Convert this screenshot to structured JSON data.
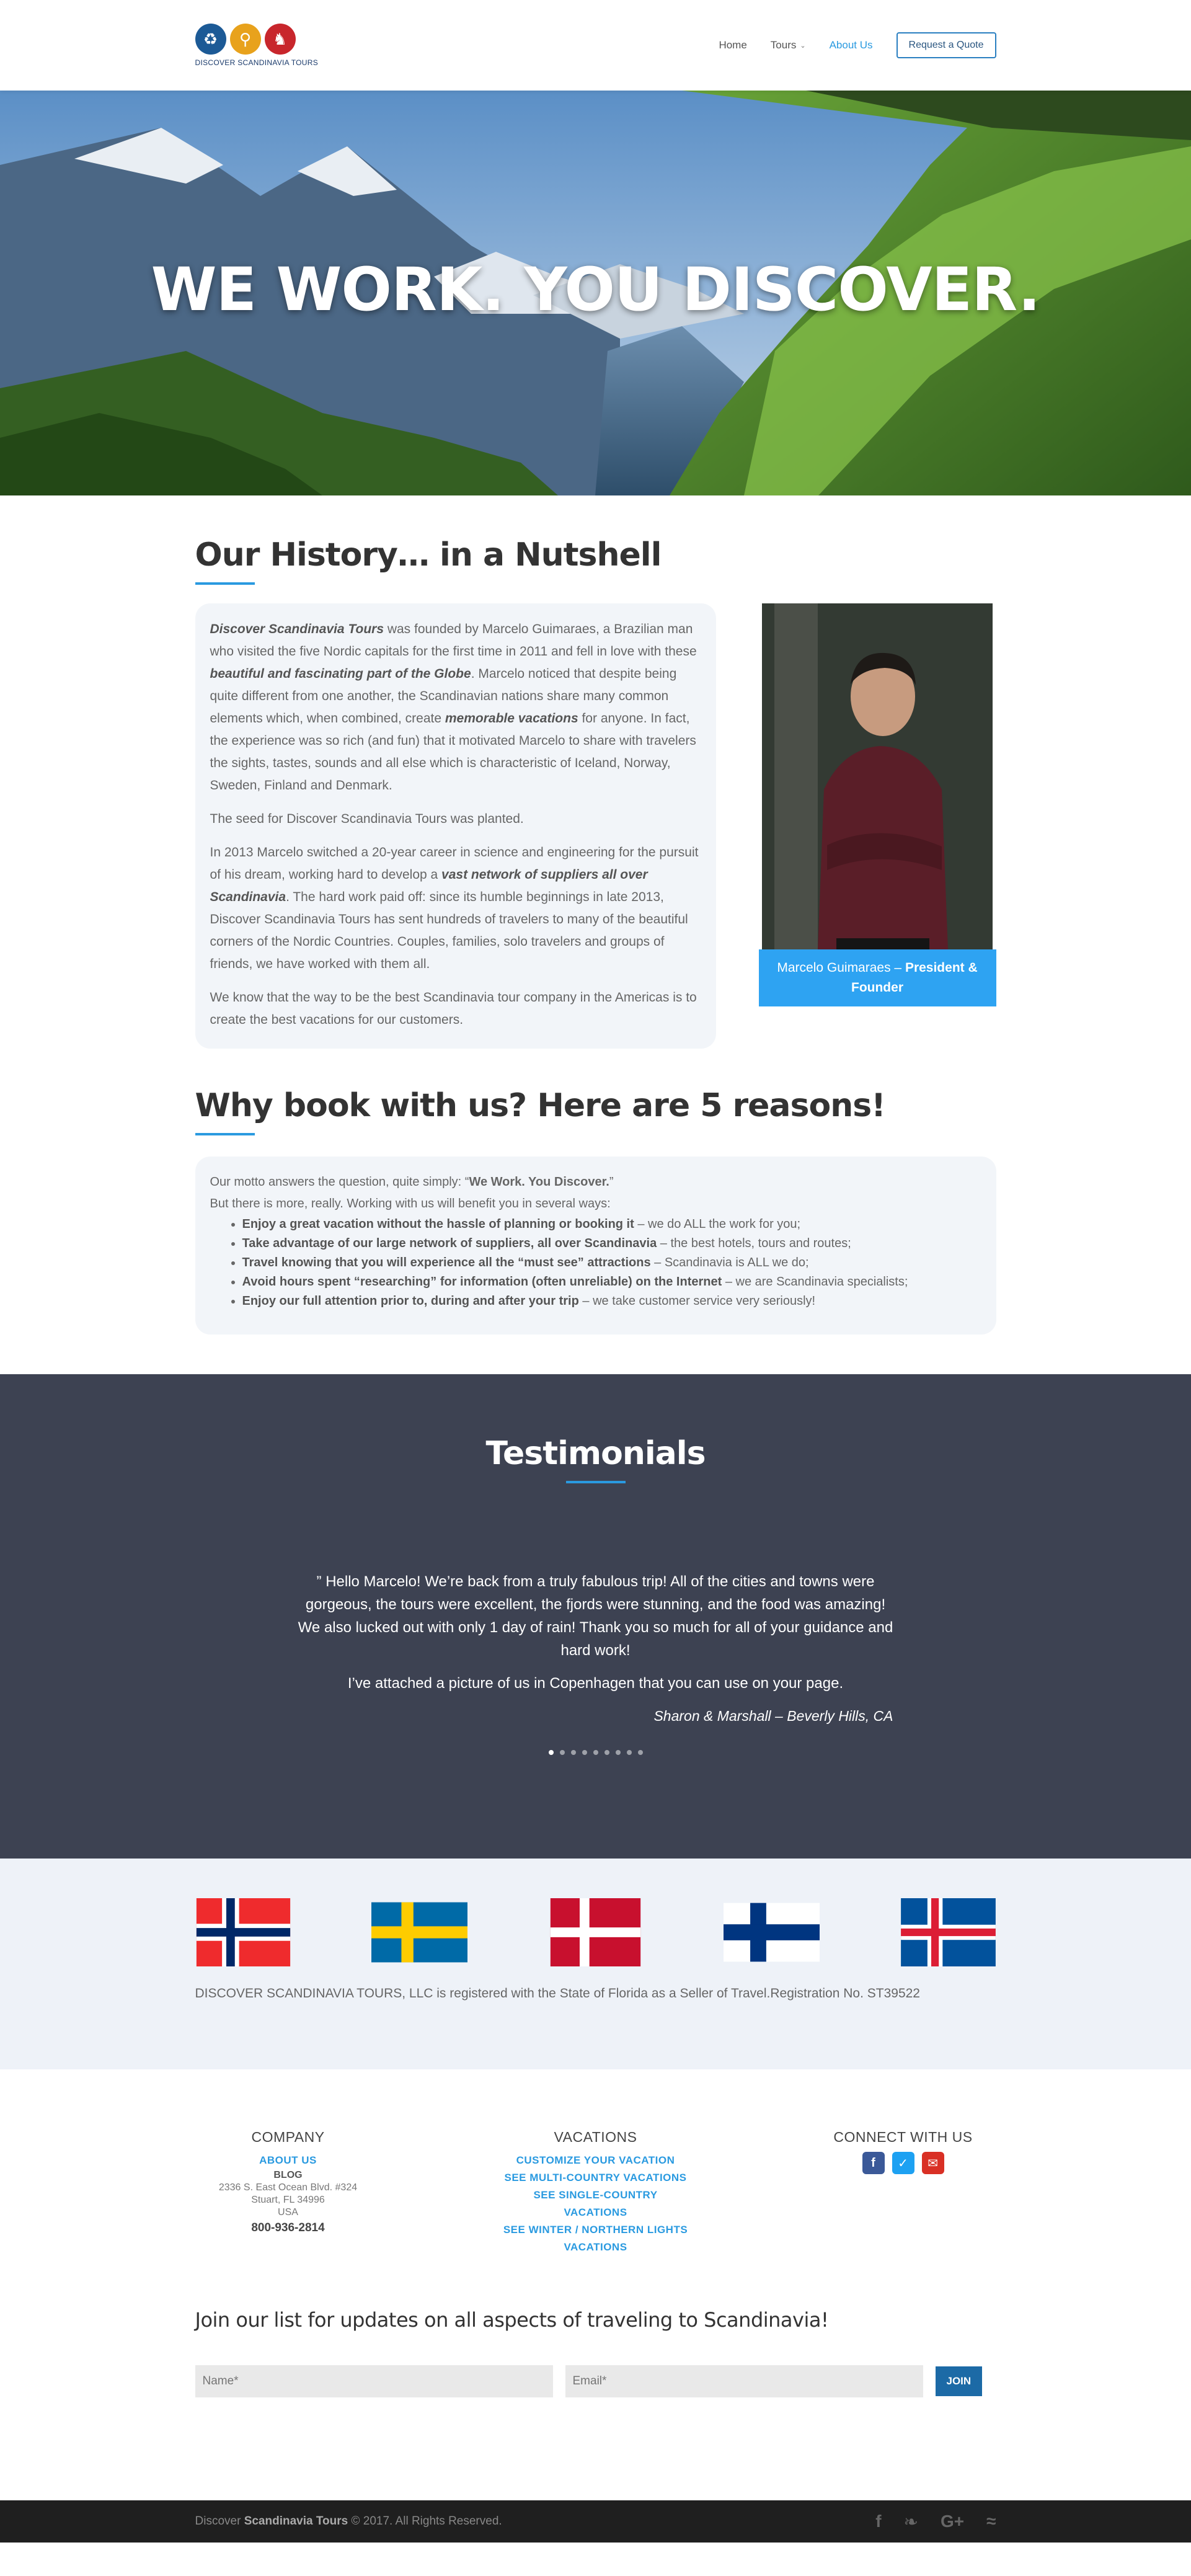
{
  "header": {
    "logo_text": "DISCOVER SCANDINAVIA TOURS",
    "nav": [
      {
        "label": "Home"
      },
      {
        "label": "Tours"
      },
      {
        "label": "About Us"
      }
    ],
    "cta": "Request a Quote"
  },
  "hero": {
    "title": "WE WORK. YOU DISCOVER."
  },
  "history": {
    "title": "Our History… in a Nutshell",
    "p1": {
      "a": "Discover Scandinavia Tours",
      "b": " was founded by Marcelo Guimaraes, a Brazilian man who visited the five Nordic capitals for the first time in 2011 and fell in love with these ",
      "c": "beautiful and fascinating part of the Globe",
      "d": ". Marcelo noticed that despite being quite different from one another, the Scandinavian nations share many common elements which, when combined, create ",
      "e": "memorable vacations",
      "f": " for anyone. In fact, the experience was so rich (and fun) that it motivated Marcelo to share with travelers the sights, tastes, sounds and all else which is characteristic of Iceland, Norway, Sweden, Finland and Denmark."
    },
    "p2": "The seed for Discover Scandinavia Tours was planted.",
    "p3": {
      "a": "In 2013 Marcelo switched a 20-year career in science and engineering for the pursuit of his dream, working hard to develop a ",
      "b": "vast network of suppliers all over Scandinavia",
      "c": ". The hard work paid off: since its humble beginnings in late 2013, Discover Scandinavia Tours has sent hundreds of travelers to many of the beautiful corners of the Nordic Countries. Couples, families, solo travelers and groups of friends, we have worked with them all."
    },
    "p4": "We know that the way to be the best Scandinavia tour company in the Americas is to create the best vacations for our customers.",
    "caption_name": "Marcelo Guimaraes – ",
    "caption_role": "President & Founder"
  },
  "reasons": {
    "title": "Why book with us? Here are 5 reasons!",
    "motto_a": "Our motto answers the question, quite simply: “",
    "motto_b": "We Work. You Discover.",
    "motto_c": "”",
    "intro": "But there is more, really. Working with us will benefit you in several ways:",
    "items": [
      {
        "bold": "Enjoy a great vacation without the hassle of planning or booking it",
        "rest": " – we do ALL the work for you;"
      },
      {
        "bold": "Take advantage of our large network of suppliers, all over Scandinavia",
        "rest": " – the best hotels, tours and routes;"
      },
      {
        "bold": "Travel knowing that you will experience all the “must see” attractions",
        "rest": " – Scandinavia is ALL we do;"
      },
      {
        "bold": "Avoid hours spent “researching” for information (often unreliable) on the Internet",
        "rest": " – we are Scandinavia specialists;"
      },
      {
        "bold": "Enjoy our full attention prior to, during and after your trip",
        "rest": " – we take customer service very seriously!"
      }
    ]
  },
  "testimonials": {
    "title": "Testimonials",
    "quote1": "” Hello Marcelo! We’re back from a truly fabulous trip! All of the cities and towns were gorgeous, the tours were excellent, the fjords were stunning, and the food was amazing! We also lucked out with only 1 day of rain! Thank you so much for all of your guidance and hard work!",
    "quote2": "I’ve attached a picture of us in Copenhagen that you can use on your page.",
    "author": "Sharon & Marshall – Beverly Hills, CA",
    "slide_count": 9,
    "active_slide": 1
  },
  "flags": {
    "items": [
      "Norway",
      "Sweden",
      "Denmark",
      "Finland",
      "Iceland"
    ],
    "registration": "DISCOVER SCANDINAVIA TOURS, LLC is registered with the State of Florida as a Seller of Travel.Registration No. ST39522"
  },
  "footer": {
    "company": {
      "title": "COMPANY",
      "about": "ABOUT US",
      "blog": "BLOG",
      "addr1": "2336 S. East Ocean Blvd. #324",
      "addr2": "Stuart, FL 34996",
      "addr3": "USA",
      "phone": "800-936-2814"
    },
    "vacations": {
      "title": "VACATIONS",
      "links": [
        "CUSTOMIZE YOUR VACATION",
        "SEE MULTI-COUNTRY VACATIONS",
        "SEE SINGLE-COUNTRY VACATIONS",
        "SEE WINTER / NORTHERN LIGHTS",
        "VACATIONS"
      ]
    },
    "connect": {
      "title": "CONNECT WITH US"
    }
  },
  "newsletter": {
    "title": "Join our list for updates on all aspects of traveling to Scandinavia!",
    "name_placeholder": "Name*",
    "email_placeholder": "Email*",
    "button": "JOIN"
  },
  "bottom": {
    "copy_a": "Discover ",
    "copy_b": "Scandinavia Tours",
    "copy_c": " © 2017. All Rights Reserved."
  },
  "colors": {
    "accent": "#2ea3f2",
    "dark_band": "#3d4252",
    "join_button": "#1c6aa6"
  }
}
